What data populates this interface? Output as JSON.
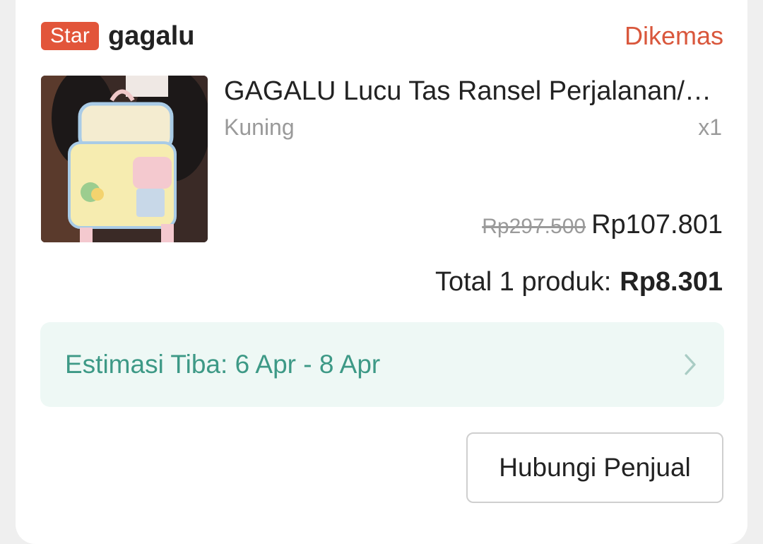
{
  "shop": {
    "badge": "Star",
    "name": "gagalu",
    "status": "Dikemas"
  },
  "product": {
    "image_icon": "backpack-product-photo",
    "name": "GAGALU Lucu Tas Ransel Perjalanan/Sekolah",
    "variant": "Kuning",
    "quantity": "x1",
    "original_price": "Rp297.500",
    "price": "Rp107.801"
  },
  "total": {
    "label": "Total 1 produk:",
    "amount": "Rp8.301"
  },
  "eta": {
    "text": "Estimasi Tiba: 6 Apr - 8 Apr",
    "icon": "chevron-right-icon"
  },
  "actions": {
    "contact_seller": "Hubungi Penjual"
  },
  "colors": {
    "accent": "#e2553a",
    "status": "#d9573c",
    "eta_text": "#3d9986",
    "eta_bg": "#eef8f5"
  }
}
